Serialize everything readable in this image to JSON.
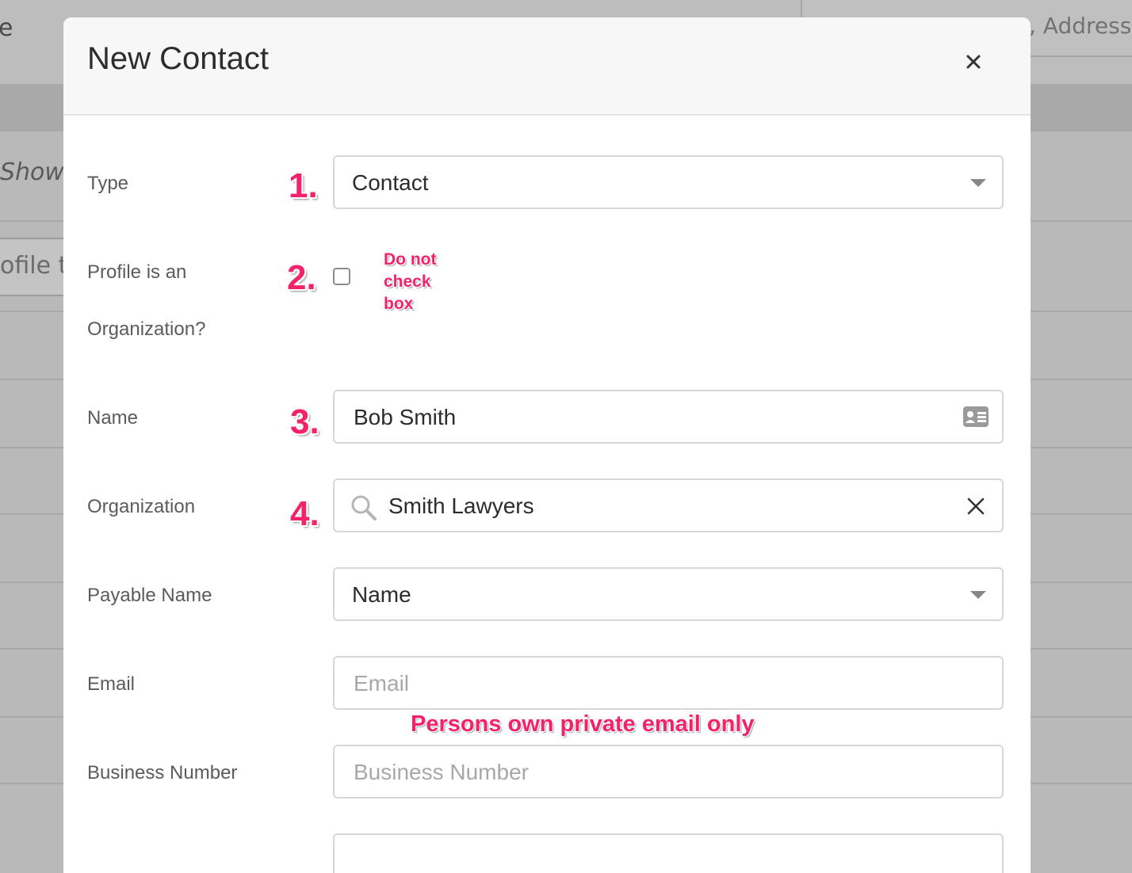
{
  "background": {
    "partial_left_text": "e",
    "search_partial_text": ", Address",
    "showing_partial_text": "Showi",
    "filter_partial_text": "ofile ty"
  },
  "modal": {
    "title": "New Contact",
    "close_icon": "close-icon"
  },
  "form": {
    "type": {
      "label": "Type",
      "value": "Contact",
      "step": "1."
    },
    "is_organization": {
      "label_line1": "Profile is an",
      "label_line2": "Organization?",
      "step": "2.",
      "checked": false,
      "note_line1": "Do not",
      "note_line2": "check",
      "note_line3": "box"
    },
    "name": {
      "label": "Name",
      "value": "Bob Smith",
      "step": "3.",
      "icon": "contact-card-icon"
    },
    "organization": {
      "label": "Organization",
      "value": "Smith Lawyers",
      "step": "4.",
      "search_icon": "search-icon",
      "clear_icon": "clear-icon"
    },
    "payable_name": {
      "label": "Payable Name",
      "value": "Name"
    },
    "email": {
      "label": "Email",
      "placeholder": "Email",
      "note": "Persons own private email only"
    },
    "business_number": {
      "label": "Business Number",
      "placeholder": "Business Number"
    }
  },
  "colors": {
    "annotation": "#f2226b",
    "overlay": "#b9b9b9",
    "border": "#d6d6d6"
  }
}
